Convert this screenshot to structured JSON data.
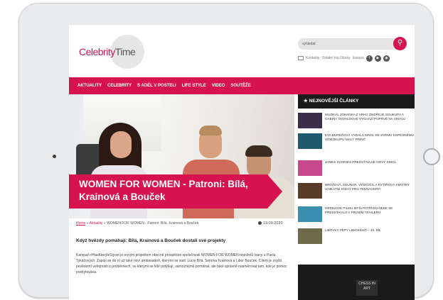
{
  "header": {
    "logo_part1": "Celebrity",
    "logo_part2": "Time",
    "search_placeholder": "vyhledat",
    "search_icon": "search-icon"
  },
  "links": {
    "contacts": "Kontakty",
    "other": "Ostatní top články",
    "advertising": "Inzerce",
    "social_icons": [
      "facebook-icon",
      "youtube-icon",
      "instagram-icon"
    ]
  },
  "nav": {
    "items": [
      "AKTUALITY",
      "CELEBRITY",
      "S ADÉL V POSTELI",
      "LIFE STYLE",
      "VIDEO",
      "SOUTĚŽE"
    ]
  },
  "article": {
    "title": "WOMEN FOR WOMEN - Patroni: Bílá, Krainová a Bouček",
    "breadcrumb_home": "Home",
    "breadcrumb_sep": " » ",
    "breadcrumb_section": "Aktuality",
    "breadcrumb_current": " » WOMEN FOR WOMEN - Patroni: Bílá, Krainová a Bouček",
    "date": "19.09.2020",
    "subtitle": "Když hvězdy pomáhají: Bílá, Krainová a Bouček dostali své projekty",
    "body": "Kampaň #HasKterýleSlyset je novým projektem obecně prospěšné společnosti WOMEN FOR WOMEN manželů Ivany a Pavla Tykačových. Zapojí se do ní už také noví ambasadoři, kterými se stali: Lucie Bílá, Simona Krainová a Libor Bouček. Cílem je zvýšit povědomí veřejnosti o problémech, se kterými se lidé potýkají, samozřejmě pomáhat, ale také správně nasměrovat tam, kde je pomoc poskytována."
  },
  "sidebar": {
    "heading": "NEJNOVĚJŠÍ ČLÁNKY",
    "items": [
      {
        "text": "Muzikál Johanka z Arku Ondřeje Soukupa a Gábiny Osvaldové vychází poprvé na vinylu",
        "color": "#3c2f4a"
      },
      {
        "text": "Eva Burešová vydala singl ke svému úspěšnému videoklipu Malý princ",
        "color": "#1f5a6e"
      },
      {
        "text": "James Harries představuje nový singl",
        "color": "#c94a8c"
      },
      {
        "text": "Brožová, Zounar, Vyskočil a rytířová kmotry unikátní knihy pro teenagery!",
        "color": "#5a3c2a"
      },
      {
        "text": "Hrdinové filmu Myši patří do nebe se představují v prvním traileru",
        "color": "#3b8fb0"
      },
      {
        "text": "Libovky Pepy Libického – 15. díl",
        "color": "#6e6a4a"
      }
    ],
    "ad_text": "CHESS IN ART"
  }
}
